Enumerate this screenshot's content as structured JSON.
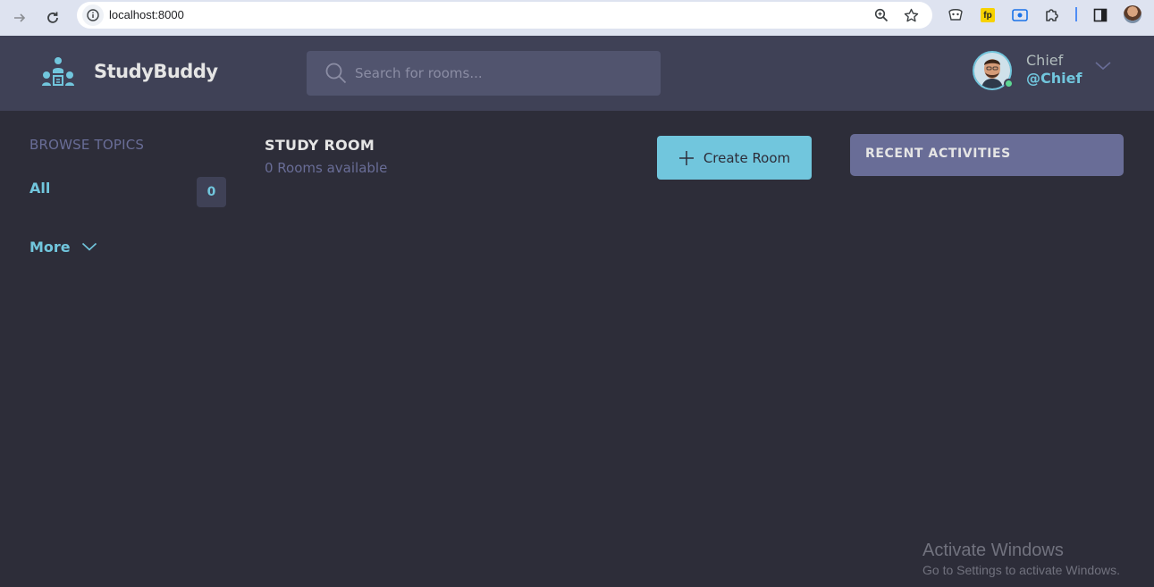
{
  "browser": {
    "url": "localhost:8000",
    "icons": [
      "forward-arrow-icon",
      "reload-icon",
      "site-info-icon",
      "zoom-icon",
      "bookmark-star-icon",
      "extension-icon",
      "fp-extension-icon",
      "screen-extension-icon",
      "puzzle-extensions-icon",
      "side-panel-icon",
      "profile-avatar-icon"
    ],
    "fp_label": "fp"
  },
  "header": {
    "brand": "StudyBuddy",
    "search_placeholder": "Search for rooms...",
    "user": {
      "name": "Chief",
      "handle": "@Chief"
    }
  },
  "sidebar": {
    "heading": "BROWSE TOPICS",
    "topics": [
      {
        "label": "All",
        "count": "0"
      }
    ],
    "more_label": "More"
  },
  "main": {
    "title": "STUDY ROOM",
    "subtitle": "0 Rooms available",
    "create_button": "Create Room"
  },
  "activities": {
    "title": "RECENT ACTIVITIES"
  },
  "watermark": {
    "title": "Activate Windows",
    "subtitle": "Go to Settings to activate Windows."
  },
  "colors": {
    "background": "#2d2d39",
    "header": "#3f4156",
    "accent": "#71c6dd",
    "muted": "#696d97",
    "online": "#5dd693"
  }
}
